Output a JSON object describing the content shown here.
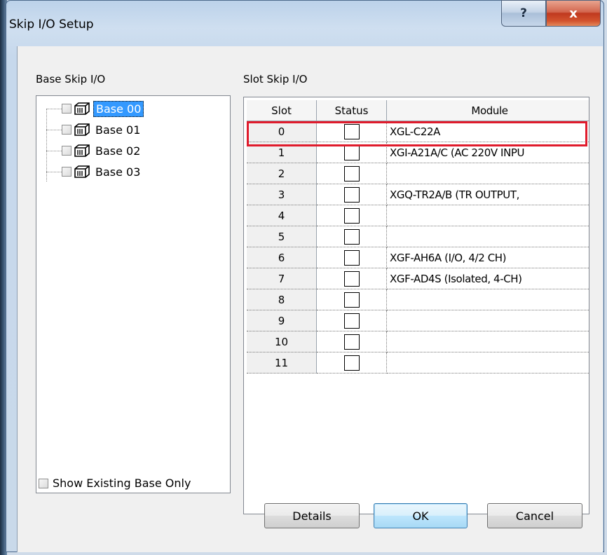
{
  "window": {
    "title": "Skip I/O Setup",
    "help_label": "?",
    "close_label": "x"
  },
  "base_skip": {
    "label": "Base Skip I/O",
    "bases": [
      {
        "label": "Base 00",
        "selected": true
      },
      {
        "label": "Base 01",
        "selected": false
      },
      {
        "label": "Base 02",
        "selected": false
      },
      {
        "label": "Base 03",
        "selected": false
      }
    ]
  },
  "slot_skip": {
    "label": "Slot Skip I/O",
    "columns": [
      "Slot",
      "Status",
      "Module"
    ],
    "rows": [
      {
        "slot": "0",
        "module": "XGL-C22A",
        "highlighted": true
      },
      {
        "slot": "1",
        "module": "XGI-A21A/C (AC 220V INPU"
      },
      {
        "slot": "2",
        "module": ""
      },
      {
        "slot": "3",
        "module": "XGQ-TR2A/B (TR OUTPUT,"
      },
      {
        "slot": "4",
        "module": ""
      },
      {
        "slot": "5",
        "module": ""
      },
      {
        "slot": "6",
        "module": "XGF-AH6A (I/O, 4/2 CH)"
      },
      {
        "slot": "7",
        "module": "XGF-AD4S (Isolated, 4-CH)"
      },
      {
        "slot": "8",
        "module": ""
      },
      {
        "slot": "9",
        "module": ""
      },
      {
        "slot": "10",
        "module": ""
      },
      {
        "slot": "11",
        "module": ""
      }
    ]
  },
  "options": {
    "show_existing_label": "Show Existing Base Only"
  },
  "buttons": {
    "details": "Details",
    "ok": "OK",
    "cancel": "Cancel"
  },
  "colors": {
    "highlight": "#e01b2c",
    "selection": "#3399ff"
  }
}
